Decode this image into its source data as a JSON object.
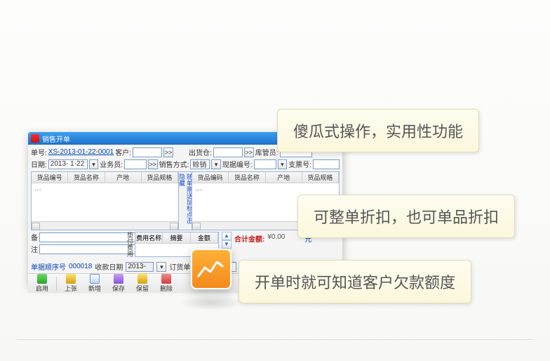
{
  "window": {
    "title": "销售开单"
  },
  "form": {
    "r1": {
      "danhao_lbl": "单号:",
      "danhao_val": "XS-2013-01-22-0001",
      "kehu_lbl": "客户:",
      "chuhuocang_lbl": "出货仓:",
      "kuguanyuan_lbl": "库管员:"
    },
    "r2": {
      "riqi_lbl": "日期:",
      "riqi_val": "2013- 1-22",
      "yewuyuan_lbl": "业务员:",
      "xiaoshoufangshi_lbl": "销售方式:",
      "xiaoshoufangshi_val": "赊销",
      "xianjubianhao_lbl": "现据编号:",
      "zhipiaohao_lbl": "支票号:"
    }
  },
  "grid_left": {
    "h0": "货品编号",
    "h1": "货品名称",
    "h2": "产地",
    "h3": "货品规格"
  },
  "grid_right": {
    "h0": "货品编码",
    "h1": "货品名称",
    "h2": "产地",
    "h3": "货品规格"
  },
  "mid_strip": "随单赠送鼠标点击隐藏",
  "remarks": {
    "bei": "备",
    "zhu": "注"
  },
  "fee": {
    "side": "垫付费用",
    "h0": "费用名称",
    "h1": "摘要",
    "h2": "金额"
  },
  "arrows": {
    "up": "▲",
    "down": "▼"
  },
  "total": {
    "label": "合计金额:",
    "value": "¥0.00",
    "unit": "元"
  },
  "status": {
    "danju_lbl": "单据顺序号",
    "danju_val": "000018",
    "shoukuan_lbl": "收款日期",
    "shoukuan_val": "2013-",
    "dingdan_lbl": "订货单号"
  },
  "tools": {
    "t0": "启用",
    "t1": "上张",
    "t2": "新增",
    "t3": "保存",
    "t4": "保留",
    "t5": "删除"
  },
  "callouts": {
    "c1": "傻瓜式操作，实用性功能",
    "c2": "可整单折扣，也可单品折扣",
    "c3": "开单时就可知道客户欠款额度"
  },
  "btn_text": ">>",
  "dropdown_caret": "▾",
  "sep": "|",
  "dots": "…"
}
